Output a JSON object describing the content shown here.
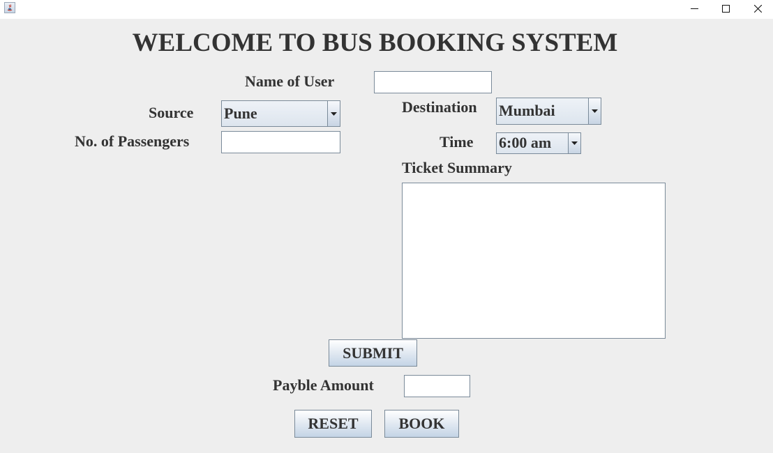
{
  "titlebar": {
    "icons": {
      "app": "java-app-icon",
      "minimize": "minimize-icon",
      "maximize": "maximize-icon",
      "close": "close-icon"
    }
  },
  "form": {
    "heading": "WELCOME TO BUS BOOKING SYSTEM",
    "name_label": "Name of User",
    "name_value": "",
    "source_label": "Source",
    "source_value": "Pune",
    "destination_label": "Destination",
    "destination_value": "Mumbai",
    "passengers_label": "No. of Passengers",
    "passengers_value": "",
    "time_label": "Time",
    "time_value": "6:00 am",
    "summary_label": "Ticket Summary",
    "summary_value": "",
    "submit_label": "SUBMIT",
    "amount_label": "Payble Amount",
    "amount_value": "",
    "reset_label": "RESET",
    "book_label": "BOOK"
  }
}
